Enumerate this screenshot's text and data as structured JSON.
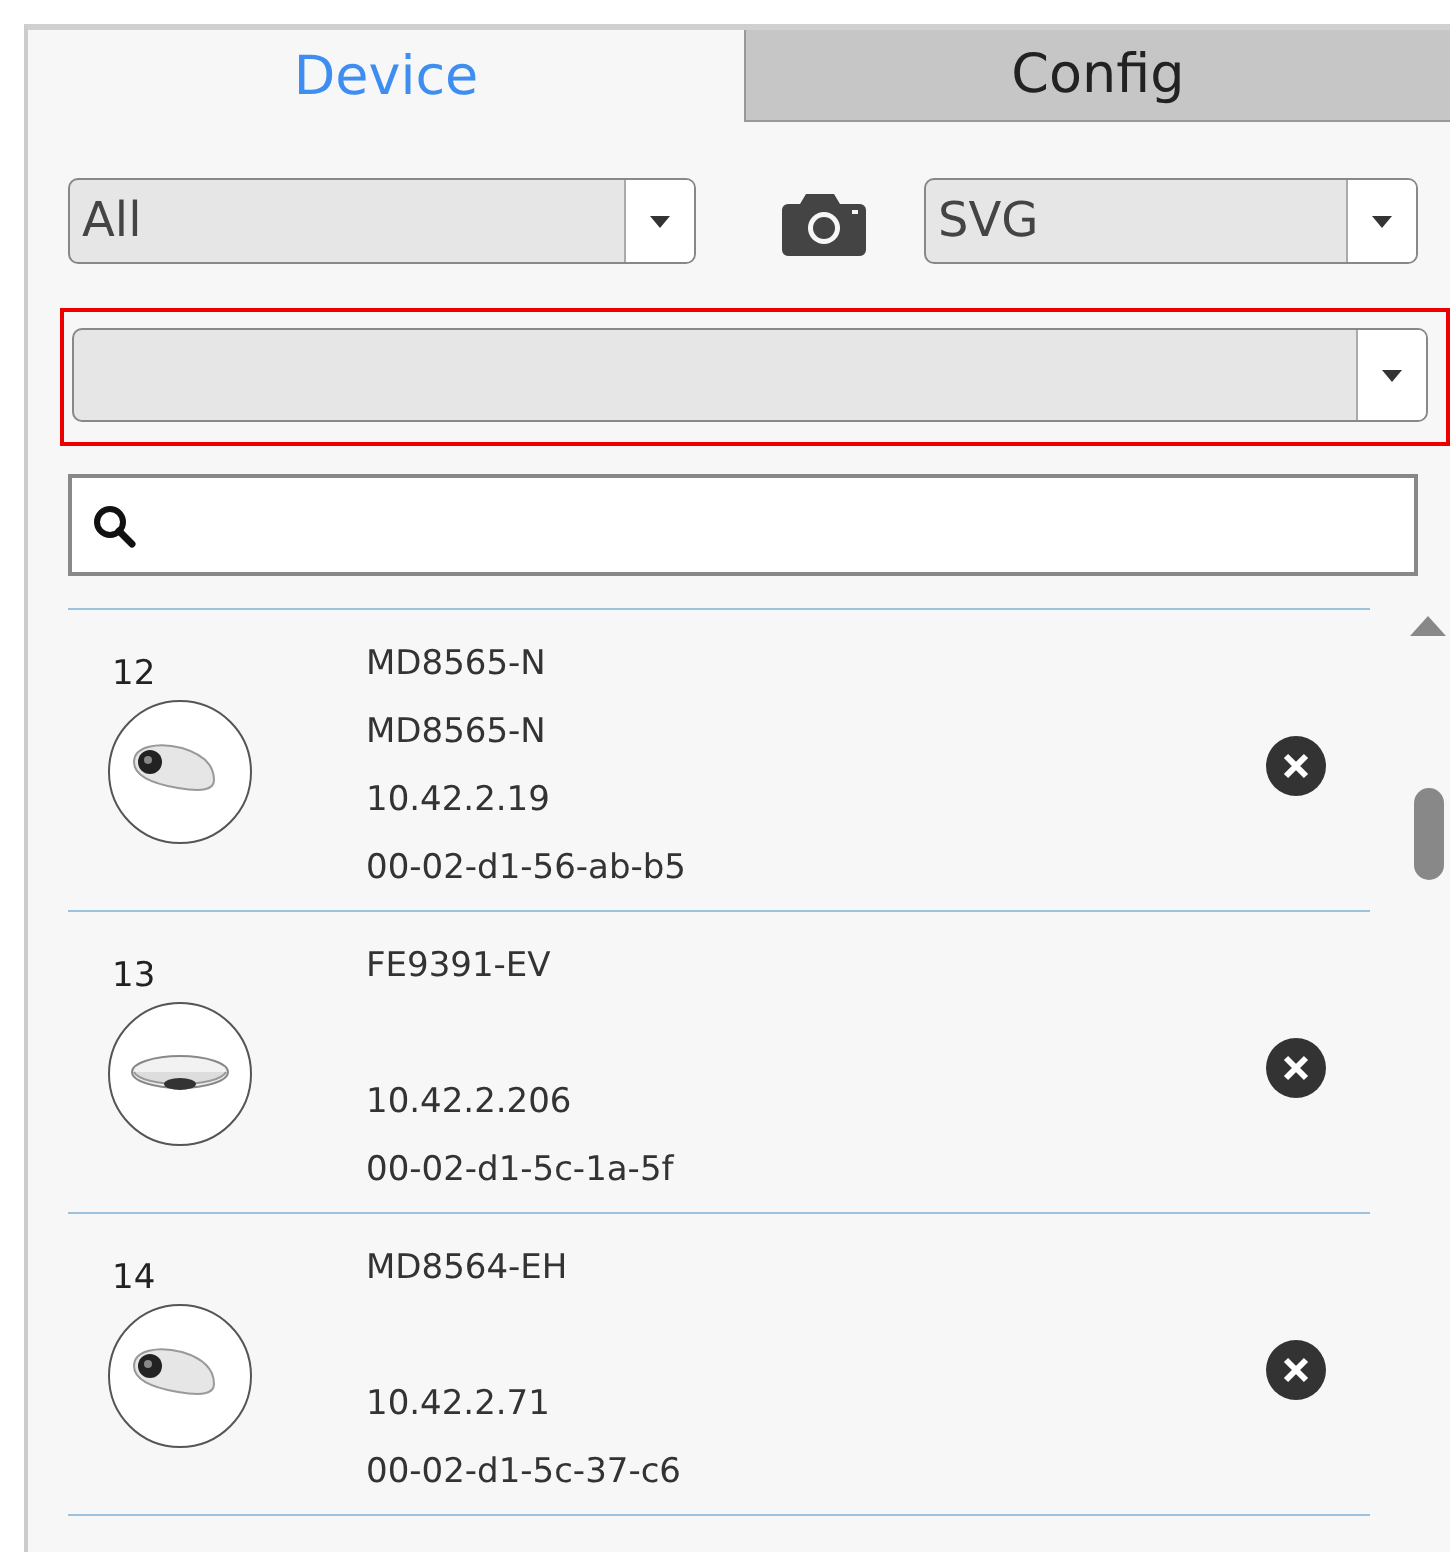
{
  "tabs": [
    {
      "label": "Device",
      "selected": true
    },
    {
      "label": "Config",
      "selected": false
    }
  ],
  "filter_dropdown": {
    "value": "All"
  },
  "format_dropdown": {
    "value": "SVG"
  },
  "group_dropdown": {
    "highlighted": true
  },
  "devices": [
    {
      "number": "12",
      "kind": "mini-dome",
      "model": "MD8565-N",
      "name": "MD8565-N",
      "ip": "10.42.2.19",
      "mac": "00-02-d1-56-ab-b5"
    },
    {
      "number": "13",
      "kind": "fisheye",
      "model": "FE9391-EV",
      "ip": "10.42.2.206",
      "mac": "00-02-d1-5c-1a-5f"
    },
    {
      "number": "14",
      "kind": "mini-dome",
      "model": "MD8564-EH",
      "ip": "10.42.2.71",
      "mac": "00-02-d1-5c-37-c6"
    }
  ]
}
